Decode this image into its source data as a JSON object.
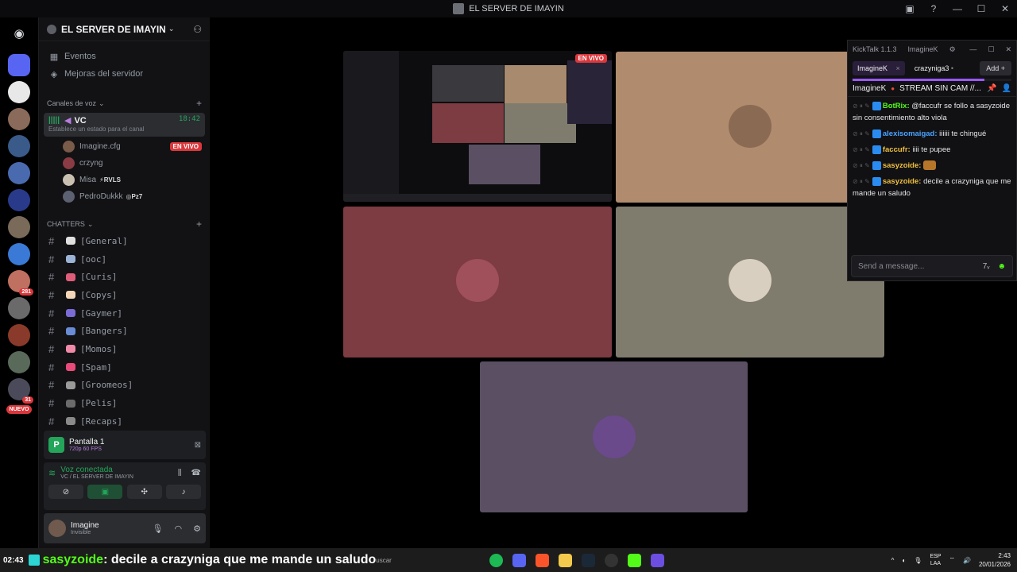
{
  "window": {
    "title": "EL SERVER DE IMAYIN"
  },
  "rail": {
    "badges": [
      "281",
      "31"
    ],
    "new_label": "NUEVO"
  },
  "sidebar": {
    "guild_name": "EL SERVER DE IMAYIN",
    "top_items": [
      {
        "label": "Eventos",
        "icon": "calendar-icon"
      },
      {
        "label": "Mejoras del servidor",
        "icon": "boost-icon"
      }
    ],
    "voice_category": "Canales de voz",
    "voice_channel": {
      "name": "VC",
      "status": "Establece un estado para el canal",
      "time": "18:42"
    },
    "voice_users": [
      {
        "name": "Imagine.cfg",
        "live": "EN VIVO",
        "color": "#7a5a48"
      },
      {
        "name": "crzyng",
        "color": "#8a3b43"
      },
      {
        "name": "Misa",
        "tag": "RVLS",
        "color": "#c9c0b2"
      },
      {
        "name": "PedroDukkk",
        "tag": "Pz7",
        "color": "#5b6170"
      }
    ],
    "text_category": "CHATTERS",
    "text_channels": [
      {
        "name": "[General]",
        "color": "#e0e0e0"
      },
      {
        "name": "[ooc]",
        "color": "#9bb4d6"
      },
      {
        "name": "[Curis]",
        "color": "#e05d7a"
      },
      {
        "name": "[Copys]",
        "color": "#f4d7b8"
      },
      {
        "name": "[Gaymer]",
        "color": "#7a6bd6"
      },
      {
        "name": "[Bangers]",
        "color": "#6a8cd6"
      },
      {
        "name": "[Momos]",
        "color": "#f08aa8"
      },
      {
        "name": "[Spam]",
        "color": "#e94a7a"
      },
      {
        "name": "[Groomeos]",
        "color": "#9a9a9a"
      },
      {
        "name": "[Pelis]",
        "color": "#6b6b6b"
      },
      {
        "name": "[Recaps]",
        "color": "#8a8a8a"
      }
    ],
    "screen_share": {
      "title": "Pantalla 1",
      "quality": "720p 60 FPS"
    },
    "voice_connected": {
      "title": "Voz conectada",
      "location": "VC / EL SERVER DE IMAYIN"
    },
    "user": {
      "name": "Imagine",
      "status": "Invisible"
    }
  },
  "stage": {
    "live_label": "EN VIVO",
    "tiles": [
      {
        "name": "screen-share",
        "color": "#0d0d10"
      },
      {
        "name": "participant-1",
        "color": "#b08b6e",
        "avatar_color": "#8a6a52"
      },
      {
        "name": "participant-2",
        "color": "#7d3b42",
        "avatar_color": "#a0505a"
      },
      {
        "name": "participant-3",
        "color": "#7f7c6e",
        "avatar_color": "#d8cfc0"
      },
      {
        "name": "participant-4",
        "color": "#5a4f63",
        "avatar_color": "#6a4a8a"
      }
    ]
  },
  "kicktalk": {
    "app_title": "KickTalk 1.1.3",
    "account": "ImagineK",
    "tabs": [
      {
        "label": "ImagineK",
        "active": true
      },
      {
        "label": "crazyniga3"
      }
    ],
    "add_label": "Add",
    "progress": 0.83,
    "channel": "ImagineK",
    "stream_title": "STREAM SIN CAM //...",
    "messages": [
      {
        "user": "BotRix:",
        "user_color": "#53fc18",
        "text": "@faccufr se follo a sasyzoide sin consentimiento alto viola"
      },
      {
        "user": "alexisomaigad:",
        "user_color": "#4aa3ff",
        "text": "iiiiii te chingué"
      },
      {
        "user": "faccufr:",
        "user_color": "#f0c040",
        "text": "iiii te pupee"
      },
      {
        "user": "sasyzoide:",
        "user_color": "#f0c040",
        "text": ""
      },
      {
        "user": "sasyzoide:",
        "user_color": "#f0c040",
        "text": "decile a crazyniga que me mande un saludo"
      }
    ],
    "input_placeholder": "Send a message..."
  },
  "taskbar": {
    "time_left": "02:43",
    "overlay_user": "sasyzoide",
    "overlay_text": ": decile a crazyniga que me mande un saludo",
    "search_hint": "uscar",
    "lang_top": "ESP",
    "lang_bottom": "LAA",
    "clock_time": "2:43",
    "clock_date": "20/01/2026"
  }
}
